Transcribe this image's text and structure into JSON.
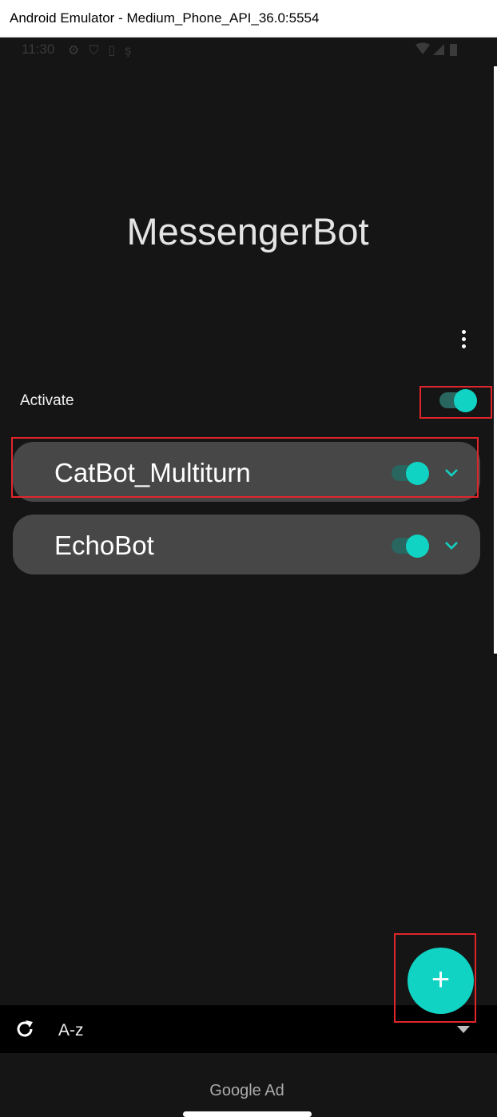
{
  "window": {
    "title": "Android Emulator - Medium_Phone_API_36.0:5554"
  },
  "status_bar": {
    "time": "11:30",
    "left_icons": [
      "settings-icon",
      "shield-icon",
      "sim-icon",
      "debug-icon"
    ],
    "right_icons": [
      "wifi-icon",
      "signal-icon",
      "battery-icon"
    ]
  },
  "app": {
    "title": "MessengerBot",
    "menu_icon": "more-vert-icon"
  },
  "activate": {
    "label": "Activate",
    "on": true
  },
  "bots": [
    {
      "name": "CatBot_Multiturn",
      "enabled": true,
      "expand_icon": "chevron-down-icon"
    },
    {
      "name": "EchoBot",
      "enabled": true,
      "expand_icon": "chevron-down-icon"
    }
  ],
  "fab": {
    "label": "+",
    "icon": "add-icon"
  },
  "sort_bar": {
    "refresh_icon": "refresh-icon",
    "sort_label": "A-z",
    "dropdown_icon": "dropdown-arrow-icon"
  },
  "ad": {
    "label": "Google Ad"
  },
  "colors": {
    "accent": "#11d3c3",
    "track": "#296660",
    "card": "#474747",
    "background": "#151515",
    "annotation": "#e0262a"
  }
}
